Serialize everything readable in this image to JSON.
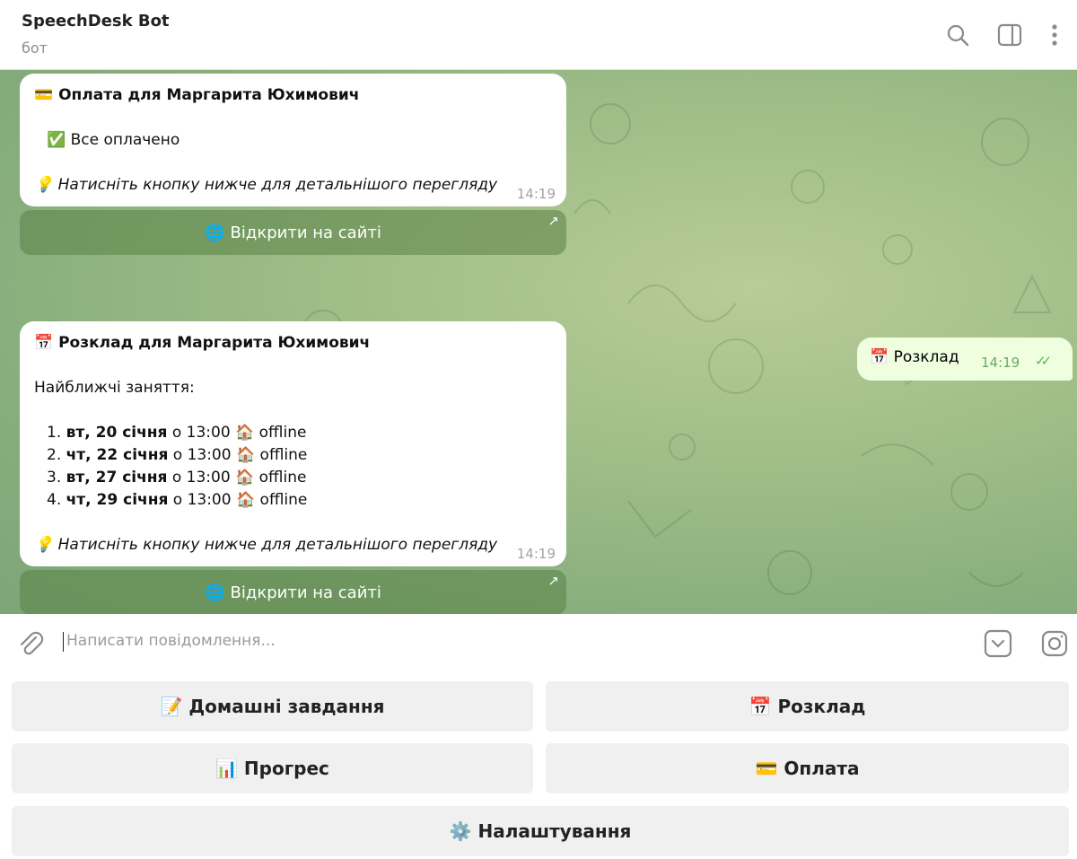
{
  "header": {
    "title": "SpeechDesk Bot",
    "subtitle": "бот"
  },
  "messages": {
    "payment": {
      "title_emoji": "💳",
      "title": "Оплата для Маргарита Юхимович",
      "status_emoji": "✅",
      "status": "Все оплачено",
      "hint_emoji": "💡",
      "hint": "Натисніть кнопку нижче для детальнішого перегляду",
      "time": "14:19",
      "button_emoji": "🌐",
      "button": "Відкрити на сайті"
    },
    "outgoing": {
      "emoji": "📅",
      "text": "Розклад",
      "time": "14:19"
    },
    "schedule": {
      "title_emoji": "📅",
      "title": "Розклад для Маргарита Юхимович",
      "subtitle": "Найближчі заняття:",
      "items": [
        {
          "num": "1.",
          "day": "вт, 20 січня",
          "rest": "о 13:00",
          "emoji": "🏠",
          "mode": "offline"
        },
        {
          "num": "2.",
          "day": "чт, 22 січня",
          "rest": "о 13:00",
          "emoji": "🏠",
          "mode": "offline"
        },
        {
          "num": "3.",
          "day": "вт, 27 січня",
          "rest": "о 13:00",
          "emoji": "🏠",
          "mode": "offline"
        },
        {
          "num": "4.",
          "day": "чт, 29 січня",
          "rest": "о 13:00",
          "emoji": "🏠",
          "mode": "offline"
        }
      ],
      "hint_emoji": "💡",
      "hint": "Натисніть кнопку нижче для детальнішого перегляду",
      "time": "14:19",
      "button_emoji": "🌐",
      "button": "Відкрити на сайті"
    }
  },
  "input": {
    "placeholder": "Написати повідомлення..."
  },
  "keyboard": {
    "homework": "📝 Домашні завдання",
    "schedule": "📅 Розклад",
    "progress": "📊 Прогрес",
    "payment": "💳 Оплата",
    "settings": "⚙️ Налаштування"
  },
  "icons": {
    "search": "search-icon",
    "sidebar": "sidebar-toggle-icon",
    "menu": "more-vertical-icon",
    "attach": "paperclip-icon",
    "keyboard": "bot-keyboard-icon",
    "camera": "camera-icon"
  },
  "colors": {
    "outgoing_bubble": "#eefedf",
    "inline_button": "#6e9358",
    "check": "#5fb65a"
  }
}
